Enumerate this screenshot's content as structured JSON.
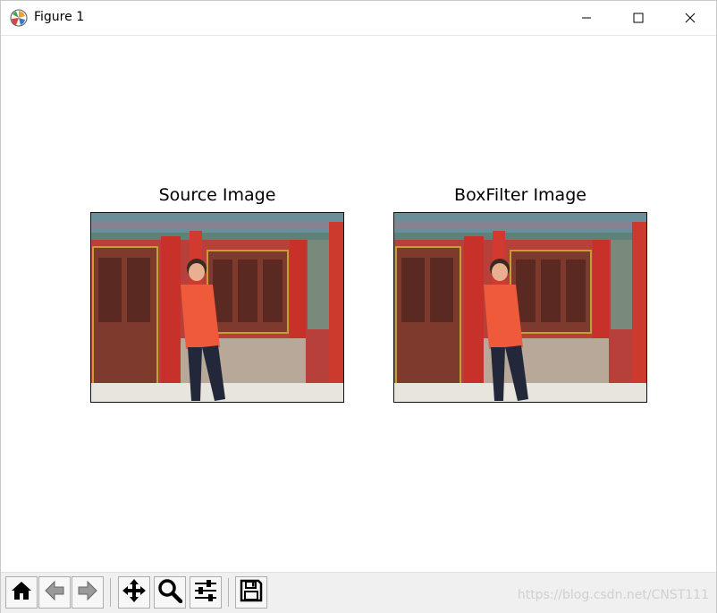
{
  "window": {
    "title": "Figure 1",
    "app_icon": "matplotlib-icon",
    "controls": {
      "minimize_icon": "minimize-icon",
      "maximize_icon": "maximize-icon",
      "close_icon": "close-icon"
    }
  },
  "figure": {
    "axes": [
      {
        "title": "Source Image",
        "content": "photo"
      },
      {
        "title": "BoxFilter Image",
        "content": "photo"
      }
    ]
  },
  "toolbar": {
    "buttons": [
      {
        "icon": "home-icon"
      },
      {
        "icon": "back-arrow-icon"
      },
      {
        "icon": "forward-arrow-icon"
      },
      {
        "icon": "pan-icon"
      },
      {
        "icon": "zoom-icon"
      },
      {
        "icon": "configure-subplots-icon"
      },
      {
        "icon": "save-icon"
      }
    ],
    "watermark": "https://blog.csdn.net/CNST111"
  },
  "colors": {
    "wall_red": "#b8403a",
    "pillar_red": "#c8302a",
    "door_brown": "#7e3a2c",
    "shirt_orange": "#ee5a3a",
    "jeans_blue": "#23273a",
    "sky_eaves": "#6a8f9a"
  }
}
